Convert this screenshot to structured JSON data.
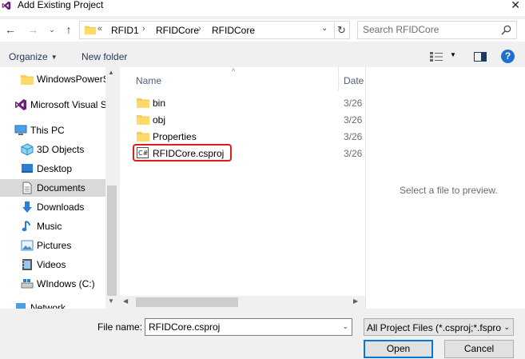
{
  "window": {
    "title": "Add Existing Project",
    "icon": "visual-studio-icon",
    "close_glyph": "✕"
  },
  "address": {
    "overflow": "«",
    "crumbs": [
      "RFID1",
      "RFIDCore",
      "RFIDCore"
    ],
    "separator": "›"
  },
  "search": {
    "placeholder": "Search RFIDCore"
  },
  "toolbar": {
    "organize_label": "Organize",
    "new_folder_label": "New folder",
    "help_label": "?"
  },
  "sidebar": {
    "items": [
      {
        "label": "WindowsPowerS",
        "icon": "folder-icon"
      },
      {
        "label": "Microsoft Visual S",
        "icon": "visual-studio-icon"
      },
      {
        "label": "This PC",
        "icon": "pc-icon"
      },
      {
        "label": "3D Objects",
        "icon": "cube-icon"
      },
      {
        "label": "Desktop",
        "icon": "desktop-icon"
      },
      {
        "label": "Documents",
        "icon": "document-icon",
        "selected": true
      },
      {
        "label": "Downloads",
        "icon": "download-icon"
      },
      {
        "label": "Music",
        "icon": "music-icon"
      },
      {
        "label": "Pictures",
        "icon": "pictures-icon"
      },
      {
        "label": "Videos",
        "icon": "video-icon"
      },
      {
        "label": "WIndows (C:)",
        "icon": "drive-icon"
      },
      {
        "label": "Network",
        "icon": "network-icon"
      }
    ]
  },
  "filelist": {
    "columns": {
      "name": "Name",
      "date": "Date"
    },
    "rows": [
      {
        "name": "bin",
        "date": "3/26",
        "icon": "folder-icon"
      },
      {
        "name": "obj",
        "date": "3/26",
        "icon": "folder-icon"
      },
      {
        "name": "Properties",
        "date": "3/26",
        "icon": "folder-icon"
      },
      {
        "name": "RFIDCore.csproj",
        "date": "3/26",
        "icon": "csharp-project-icon",
        "highlighted": true
      }
    ]
  },
  "preview": {
    "message": "Select a file to preview."
  },
  "footer": {
    "file_name_label": "File name:",
    "file_name_value": "RFIDCore.csproj",
    "file_type_value": "All Project Files (*.csproj;*.fspro",
    "open_label": "Open",
    "cancel_label": "Cancel"
  },
  "colors": {
    "highlight": "#e01b1b",
    "selected_nav": "#d9d9d9",
    "folder": "#f5cd5c",
    "accent": "#0078d7"
  }
}
